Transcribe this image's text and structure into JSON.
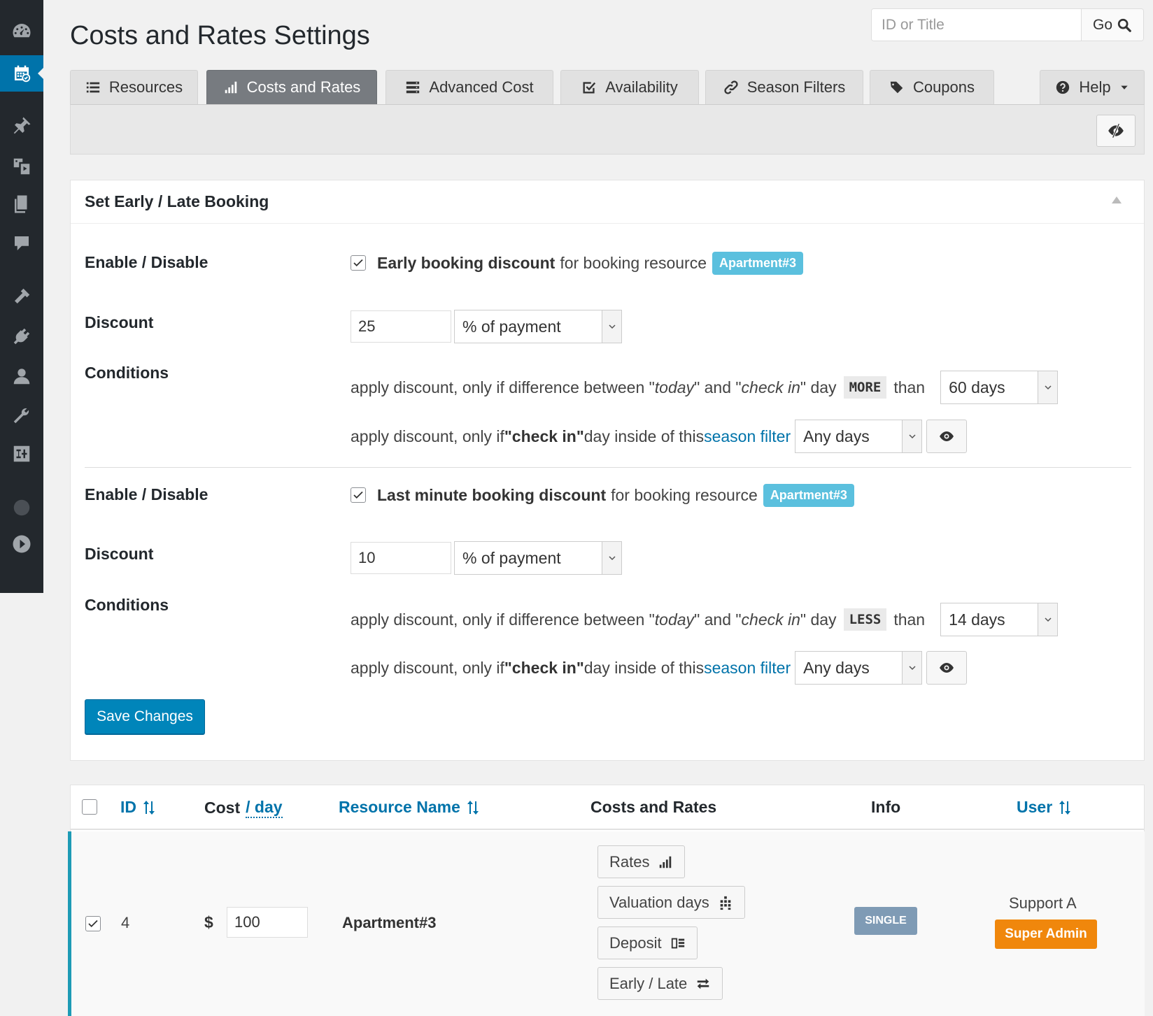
{
  "page": {
    "title": "Costs and Rates Settings"
  },
  "search": {
    "placeholder": "ID or Title",
    "go_label": "Go"
  },
  "tabs": [
    {
      "label": "Resources",
      "icon": "list-icon"
    },
    {
      "label": "Costs and Rates",
      "icon": "bar-chart-icon",
      "active": true
    },
    {
      "label": "Advanced Cost",
      "icon": "stack-icon"
    },
    {
      "label": "Availability",
      "icon": "check-square-icon"
    },
    {
      "label": "Season Filters",
      "icon": "link-icon"
    },
    {
      "label": "Coupons",
      "icon": "tags-icon"
    },
    {
      "label": "Help",
      "icon": "question-circle-icon"
    }
  ],
  "panel": {
    "title": "Set Early / Late Booking",
    "early": {
      "enable_label": "Enable / Disable",
      "discount_name": "Early booking discount",
      "for_text": "for booking resource",
      "resource": "Apartment#3",
      "discount_label": "Discount",
      "discount_value": "25",
      "discount_type": "% of payment",
      "conditions_label": "Conditions",
      "cond1_prefix": "apply discount, only if difference between \"",
      "cond1_today": "today",
      "cond1_mid": "\" and \"",
      "cond1_checkin": "check in",
      "cond1_suffix": "\" day",
      "cond1_op": "MORE",
      "cond1_than": "than",
      "cond1_days": "60 days",
      "cond2_prefix": "apply discount, only if ",
      "cond2_checkin": "\"check in\"",
      "cond2_mid": " day inside of this ",
      "cond2_link": "season filter",
      "cond2_value": "Any days"
    },
    "late": {
      "enable_label": "Enable / Disable",
      "discount_name": "Last minute booking discount",
      "for_text": "for booking resource",
      "resource": "Apartment#3",
      "discount_label": "Discount",
      "discount_value": "10",
      "discount_type": "% of payment",
      "conditions_label": "Conditions",
      "cond1_prefix": "apply discount, only if difference between \"",
      "cond1_today": "today",
      "cond1_mid": "\" and \"",
      "cond1_checkin": "check in",
      "cond1_suffix": "\" day",
      "cond1_op": "LESS",
      "cond1_than": "than",
      "cond1_days": "14 days",
      "cond2_prefix": "apply discount, only if ",
      "cond2_checkin": "\"check in\"",
      "cond2_mid": " day inside of this ",
      "cond2_link": "season filter",
      "cond2_value": "Any days"
    },
    "save_label": "Save Changes"
  },
  "table": {
    "headers": {
      "id": "ID",
      "cost": "Cost",
      "per_day": "/ day",
      "resource_name": "Resource Name",
      "costs_rates": "Costs and Rates",
      "info": "Info",
      "user": "User"
    },
    "rows": [
      {
        "id": "4",
        "currency": "$",
        "cost": "100",
        "name": "Apartment#3",
        "buttons": [
          "Rates",
          "Valuation days",
          "Deposit",
          "Early / Late"
        ],
        "type": "SINGLE",
        "user": "Support A",
        "role": "Super Admin"
      }
    ]
  },
  "colors": {
    "accent": "#0073aa",
    "sidebar": "#23282d",
    "badge_blue": "#5bc0de",
    "badge_orange": "#f0870c",
    "badge_gray": "#7f9bb5"
  }
}
